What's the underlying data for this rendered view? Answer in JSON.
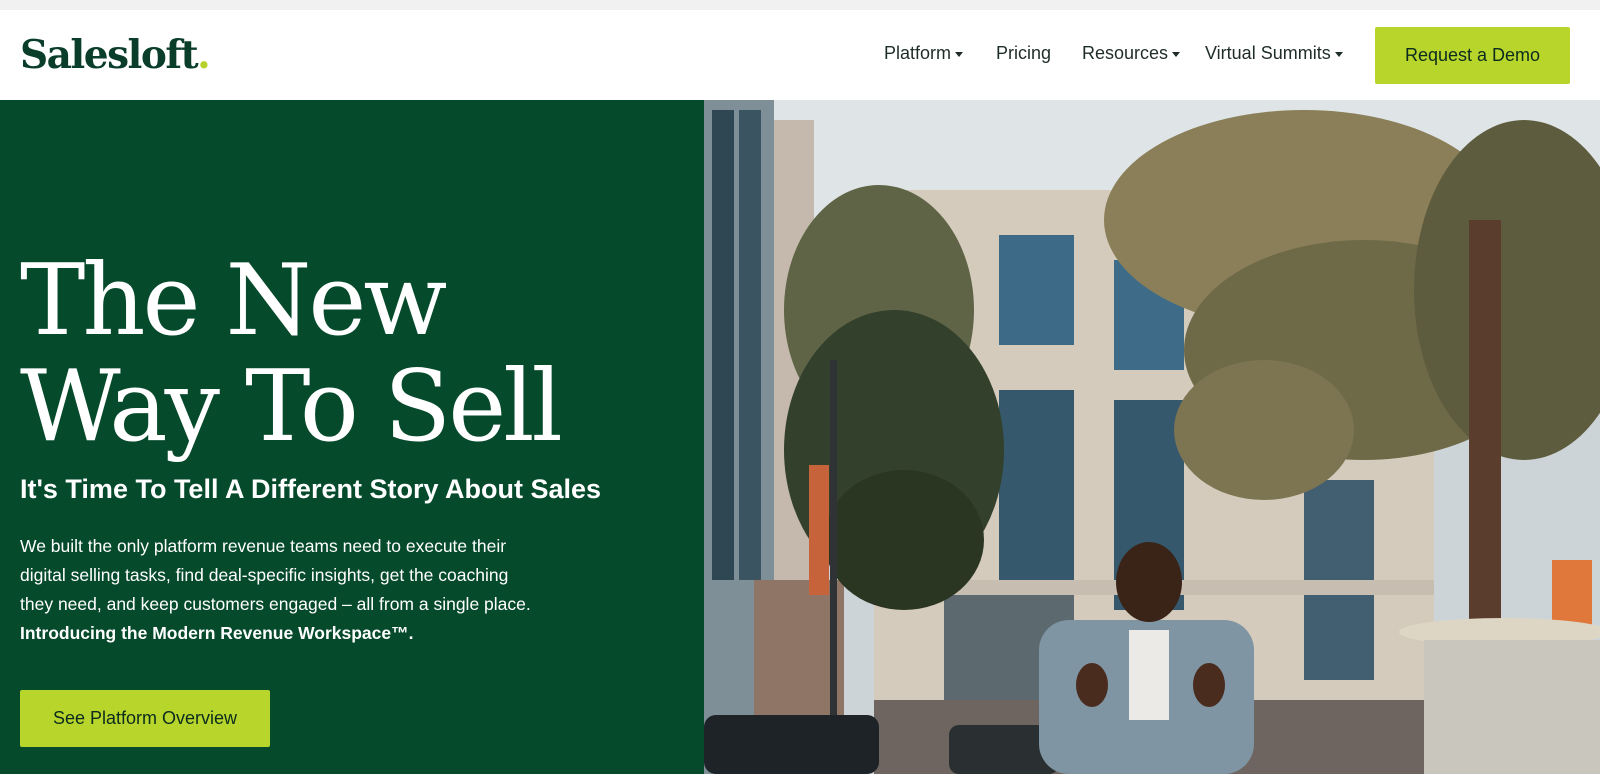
{
  "header": {
    "logo_text": "Salesloft",
    "logo_dot": ".",
    "nav": [
      {
        "label": "Platform",
        "dropdown": true
      },
      {
        "label": "Pricing",
        "dropdown": false
      },
      {
        "label": "Resources",
        "dropdown": true
      },
      {
        "label": "Virtual Summits",
        "dropdown": true
      }
    ],
    "cta_label": "Request a Demo"
  },
  "hero": {
    "headline_line1": "The New",
    "headline_line2": "Way To Sell",
    "subheadline": "It's Time To Tell A Different Story About Sales",
    "body_line1": "We built the only platform revenue teams need to execute their",
    "body_line2": "digital selling tasks, find deal-specific insights, get the coaching",
    "body_line3": "they need, and keep customers engaged – all from a single place.",
    "body_strong": "Introducing the Modern Revenue Workspace™.",
    "button_label": "See Platform Overview"
  },
  "colors": {
    "brand_green": "#064a2c",
    "accent_lime": "#b8d52c",
    "logo_green": "#0a3d2a"
  }
}
